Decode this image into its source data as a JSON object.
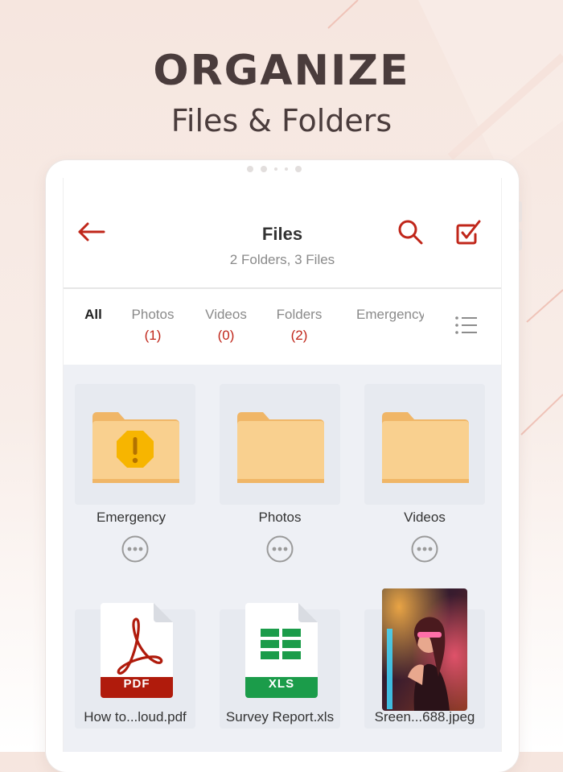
{
  "hero": {
    "title": "ORGANIZE",
    "subtitle": "Files & Folders"
  },
  "colors": {
    "accent": "#c0261a",
    "folder": "#f9d08f",
    "folder_tab": "#f0b667",
    "warning": "#f7b500",
    "pdf": "#b01b0c",
    "xls": "#1b9c4a"
  },
  "appbar": {
    "title": "Files",
    "subtitle": "2 Folders, 3 Files",
    "back_icon": "arrow-left-icon",
    "search_icon": "search-icon",
    "select_icon": "checkbox-check-icon"
  },
  "tabs": [
    {
      "label": "All",
      "count": ""
    },
    {
      "label": "Photos",
      "count": "(1)"
    },
    {
      "label": "Videos",
      "count": "(0)"
    },
    {
      "label": "Folders",
      "count": "(2)"
    },
    {
      "label": "Emergency",
      "count": ""
    }
  ],
  "view_toggle_icon": "list-icon",
  "folders": [
    {
      "name": "Emergency",
      "icon": "warning-folder-icon"
    },
    {
      "name": "Photos",
      "icon": "folder-icon"
    },
    {
      "name": "Videos",
      "icon": "folder-icon"
    }
  ],
  "files": [
    {
      "name": "How to...loud.pdf",
      "badge": "PDF",
      "icon": "pdf-file-icon"
    },
    {
      "name": "Survey Report.xls",
      "badge": "XLS",
      "icon": "xls-file-icon"
    },
    {
      "name": "Sreen...688.jpeg",
      "badge": "",
      "icon": "image-thumbnail"
    }
  ]
}
